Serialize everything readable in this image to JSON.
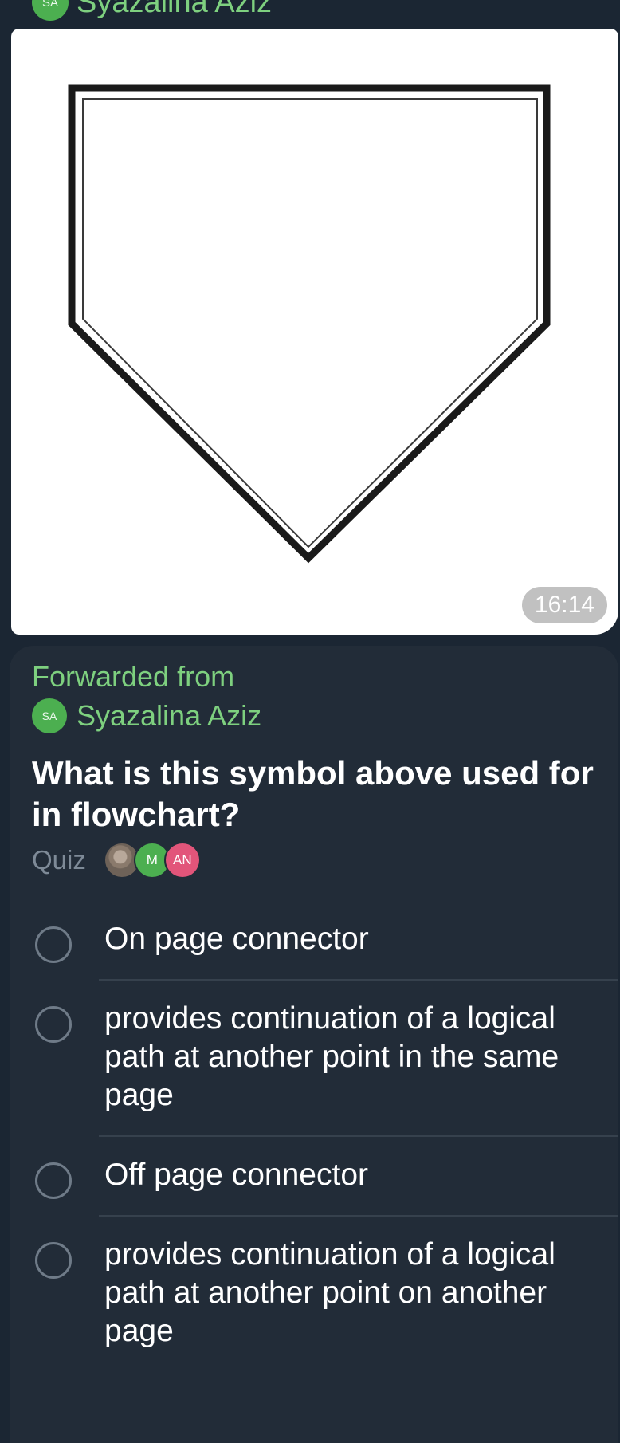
{
  "top_sender": {
    "avatar_initials": "SA",
    "name": "Syazalina Aziz"
  },
  "image_message": {
    "timestamp": "16:14"
  },
  "quiz_message": {
    "forwarded_label": "Forwarded from",
    "forwarded_sender": {
      "avatar_initials": "SA",
      "name": "Syazalina Aziz"
    },
    "question": "What is this symbol above used for in flowchart?",
    "type_label": "Quiz",
    "voters": [
      {
        "initials": ""
      },
      {
        "initials": "M"
      },
      {
        "initials": "AN"
      }
    ],
    "options": [
      "On page connector",
      "provides continuation of a logical path at another point in the same page",
      "Off page connector",
      "provides continuation of a logical path at another point on another page"
    ]
  },
  "colors": {
    "background": "#1b2633",
    "bubble": "#222c38",
    "accent_green": "#7ed07f",
    "avatar_green": "#4caf50",
    "avatar_pink": "#e2557a",
    "muted_text": "#7e8a97"
  }
}
